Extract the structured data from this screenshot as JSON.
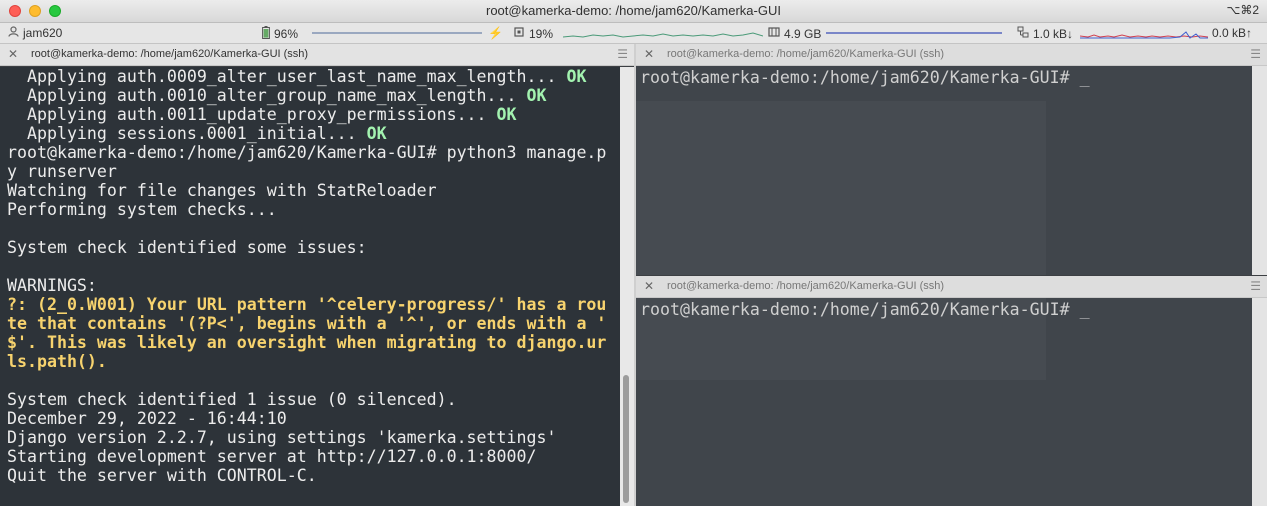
{
  "window": {
    "title": "root@kamerka-demo: /home/jam620/Kamerka-GUI",
    "shortcut": "⌥⌘2"
  },
  "statusbar": {
    "user": "jam620",
    "battery": "96%",
    "cpu": "19%",
    "memory": "4.9 GB",
    "net_down": "1.0 kB↓",
    "net_up": "0.0 kB↑"
  },
  "panes": {
    "left_title": "root@kamerka-demo: /home/jam620/Kamerka-GUI (ssh)",
    "right_top_title": "root@kamerka-demo: /home/jam620/Kamerka-GUI (ssh)",
    "right_bottom_title": "root@kamerka-demo: /home/jam620/Kamerka-GUI (ssh)"
  },
  "left_terminal": {
    "lines": [
      {
        "text": "  Applying auth.0009_alter_user_last_name_max_length... ",
        "ok": "OK"
      },
      {
        "text": "  Applying auth.0010_alter_group_name_max_length... ",
        "ok": "OK"
      },
      {
        "text": "  Applying auth.0011_update_proxy_permissions... ",
        "ok": "OK"
      },
      {
        "text": "  Applying sessions.0001_initial... ",
        "ok": "OK"
      },
      {
        "text": "root@kamerka-demo:/home/jam620/Kamerka-GUI# python3 manage.p"
      },
      {
        "text": "y runserver"
      },
      {
        "text": "Watching for file changes with StatReloader"
      },
      {
        "text": "Performing system checks..."
      },
      {
        "text": ""
      },
      {
        "text": "System check identified some issues:"
      },
      {
        "text": ""
      },
      {
        "text": "WARNINGS:"
      },
      {
        "warn": "?: (2_0.W001) Your URL pattern '^celery-progress/' has a rou"
      },
      {
        "warn": "te that contains '(?P<', begins with a '^', or ends with a '"
      },
      {
        "warn": "$'. This was likely an oversight when migrating to django.ur"
      },
      {
        "warn": "ls.path()."
      },
      {
        "text": ""
      },
      {
        "text": "System check identified 1 issue (0 silenced)."
      },
      {
        "text": "December 29, 2022 - 16:44:10"
      },
      {
        "text": "Django version 2.2.7, using settings 'kamerka.settings'"
      },
      {
        "text": "Starting development server at http://127.0.0.1:8000/"
      },
      {
        "text": "Quit the server with CONTROL-C."
      }
    ]
  },
  "right_top_terminal": {
    "prompt": "root@kamerka-demo:/home/jam620/Kamerka-GUI# _"
  },
  "right_bottom_terminal": {
    "prompt": "root@kamerka-demo:/home/jam620/Kamerka-GUI# _"
  }
}
